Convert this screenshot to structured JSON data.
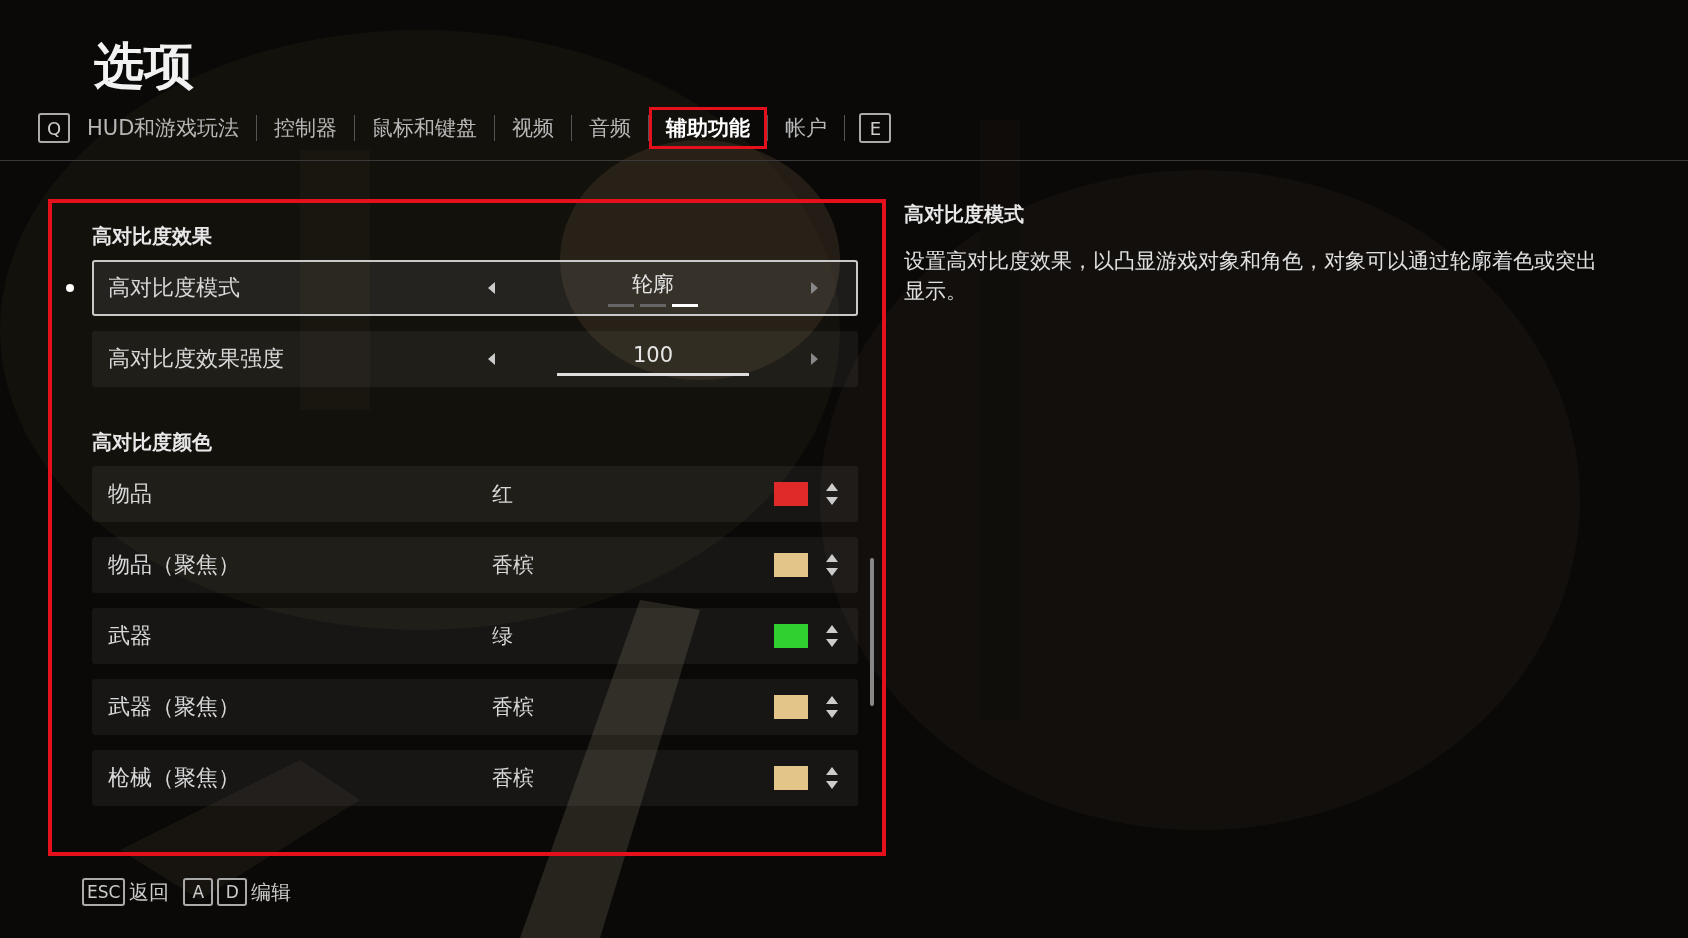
{
  "title": "选项",
  "tab_prev_key": "Q",
  "tabs": [
    {
      "label": "HUD和游戏玩法",
      "selected": false,
      "annotated": false
    },
    {
      "label": "控制器",
      "selected": false,
      "annotated": false
    },
    {
      "label": "鼠标和键盘",
      "selected": false,
      "annotated": false
    },
    {
      "label": "视频",
      "selected": false,
      "annotated": false
    },
    {
      "label": "音频",
      "selected": false,
      "annotated": false
    },
    {
      "label": "辅助功能",
      "selected": true,
      "annotated": true
    },
    {
      "label": "帐户",
      "selected": false,
      "annotated": false
    }
  ],
  "tab_next_key": "E",
  "panel": {
    "annotated": true,
    "sections": [
      {
        "heading": "高对比度效果",
        "rows": [
          {
            "kind": "selector",
            "label": "高对比度模式",
            "value": "轮廓",
            "focused": true,
            "options": [
              {
                "selected": false
              },
              {
                "selected": false
              },
              {
                "selected": true
              }
            ]
          },
          {
            "kind": "slider",
            "label": "高对比度效果强度",
            "value": "100",
            "focused": false,
            "level": 1
          }
        ]
      },
      {
        "heading": "高对比度颜色",
        "rows": [
          {
            "kind": "color",
            "label": "物品",
            "value": "红",
            "focused": false,
            "color": "#e02a2a"
          },
          {
            "kind": "color",
            "label": "物品（聚焦）",
            "value": "香槟",
            "focused": false,
            "color": "#e3c489"
          },
          {
            "kind": "color",
            "label": "武器",
            "value": "绿",
            "focused": false,
            "color": "#2fd02f"
          },
          {
            "kind": "color",
            "label": "武器（聚焦）",
            "value": "香槟",
            "focused": false,
            "color": "#e3c489"
          },
          {
            "kind": "color",
            "label": "枪械（聚焦）",
            "value": "香槟",
            "focused": false,
            "color": "#e3c489"
          }
        ]
      }
    ]
  },
  "description": {
    "heading": "高对比度模式",
    "text": "设置高对比度效果，以凸显游戏对象和角色，对象可以通过轮廓着色或突出显示。"
  },
  "footer": [
    {
      "keys": [
        "ESC"
      ],
      "label": "返回"
    },
    {
      "keys": [
        "A",
        "D"
      ],
      "label": "编辑"
    }
  ]
}
